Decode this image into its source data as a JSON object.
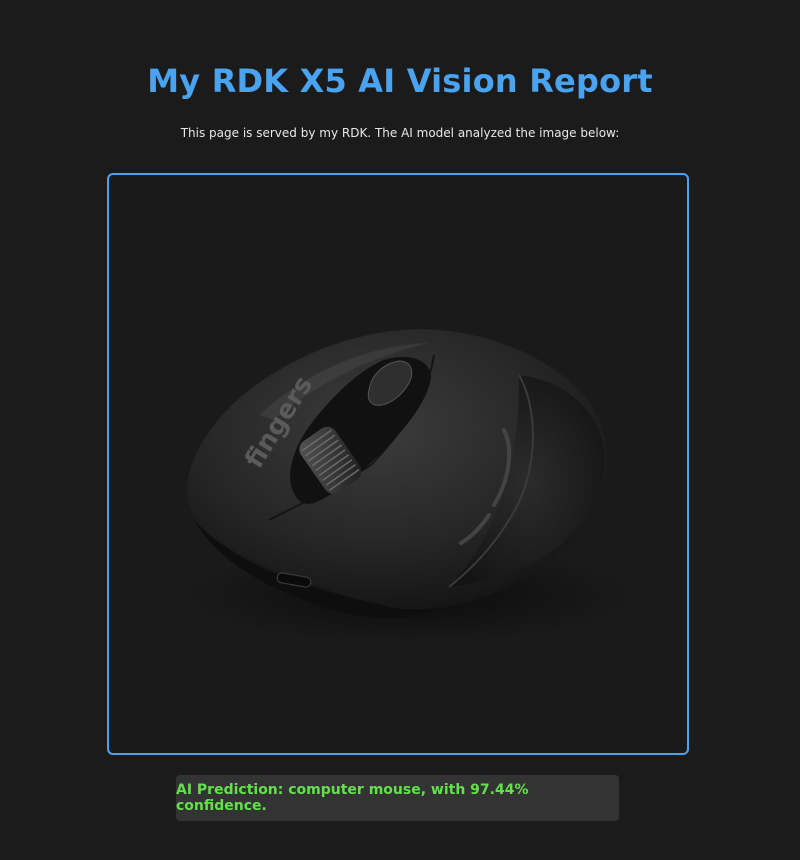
{
  "page": {
    "title": "My RDK X5 AI Vision Report",
    "subtitle": "This page is served by my RDK. The AI model analyzed the image below:"
  },
  "analyzed_image": {
    "subject": "computer mouse",
    "brand_text": "fingers",
    "frame_color": "#4aa3f0"
  },
  "prediction": {
    "text": "AI Prediction: computer mouse, with 97.44% confidence.",
    "text_color": "#62e24a"
  },
  "colors": {
    "background": "#1b1b1b",
    "accent": "#4aa3f0",
    "prediction_bg": "#333333"
  }
}
